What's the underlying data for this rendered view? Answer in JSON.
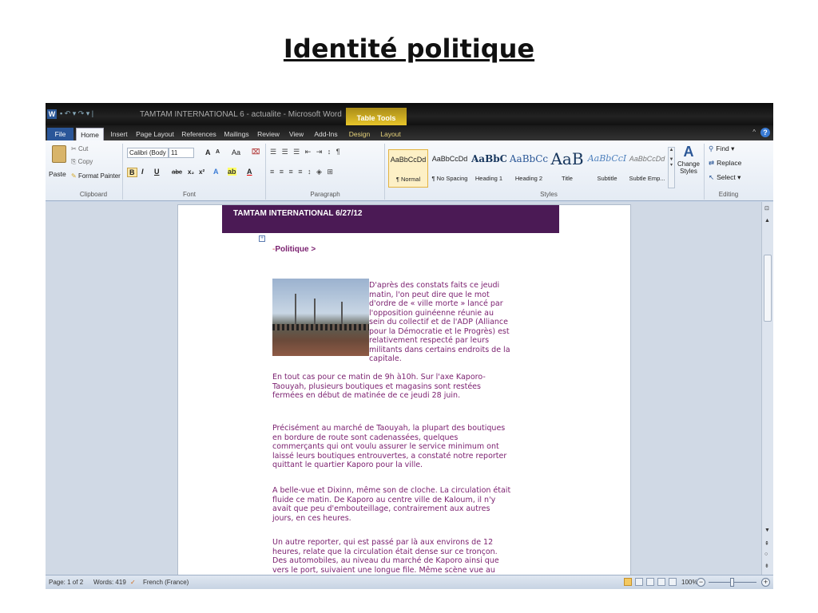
{
  "slide_title": "Identité politique",
  "window": {
    "title": "TAMTAM INTERNATIONAL 6 - actualite  -  Microsoft Word",
    "contextual_tab": "Table Tools",
    "app_icon": "W"
  },
  "tabs": [
    "File",
    "Home",
    "Insert",
    "Page Layout",
    "References",
    "Mailings",
    "Review",
    "View",
    "Add-Ins",
    "Design",
    "Layout"
  ],
  "ribbon": {
    "clipboard": {
      "paste": "Paste",
      "cut": "Cut",
      "copy": "Copy",
      "format_painter": "Format Painter",
      "label": "Clipboard"
    },
    "font": {
      "name": "Calibri (Body",
      "size": "11",
      "grow": "A",
      "shrink": "A",
      "case": "Aa",
      "label": "Font"
    },
    "paragraph": {
      "label": "Paragraph"
    },
    "styles": {
      "label": "Styles",
      "items": [
        {
          "sample": "AaBbCcDd",
          "name": "¶ Normal"
        },
        {
          "sample": "AaBbCcDd",
          "name": "¶ No Spacing"
        },
        {
          "sample": "AaBbCc",
          "name": "Heading 1"
        },
        {
          "sample": "AaBbCc",
          "name": "Heading 2"
        },
        {
          "sample": "AaB",
          "name": "Title"
        },
        {
          "sample": "AaBbCcI",
          "name": "Subtitle"
        },
        {
          "sample": "AaBbCcDd",
          "name": "Subtle Emp..."
        }
      ],
      "change_styles": "Change Styles"
    },
    "editing": {
      "find": "Find",
      "replace": "Replace",
      "select": "Select",
      "label": "Editing"
    }
  },
  "document": {
    "header": "TAMTAM INTERNATIONAL 6/27/12",
    "section": "Politique >",
    "para1": "D'après des constats faits ce jeudi matin, l'on peut dire que le mot d'ordre de « ville morte » lancé par l'opposition guinéenne réunie au sein du collectif et de l'ADP (Alliance pour la Démocratie et le Progrès) est relativement respecté par leurs militants dans certains endroits de la capitale.",
    "para2": "En tout cas pour ce matin de 9h à10h. Sur l'axe Kaporo- Taouyah, plusieurs boutiques et magasins sont restées fermées en début de matinée de ce jeudi 28 juin.",
    "para3": "Précisément au marché de Taouyah, la plupart des boutiques en bordure de route sont cadenassées, quelques commerçants qui ont voulu assurer le service minimum ont laissé leurs boutiques entrouvertes, a constaté notre reporter quittant le quartier Kaporo pour la ville.",
    "para4": "A belle-vue et Dixinn, même son de cloche. La circulation était fluide ce matin. De Kaporo au centre ville de Kaloum, il n'y avait que peu d'embouteillage, contrairement aux autres jours, en ces heures.",
    "para5": "Un autre reporter, qui est passé par là aux environs de 12 heures, relate que la circulation était dense sur ce tronçon. Des automobiles, au niveau du marché de Kaporo ainsi que vers le port, suivaient une longue file. Même scène vue au marché de Taouyah."
  },
  "status": {
    "page": "Page: 1 of 2",
    "words": "Words: 419",
    "language": "French (France)",
    "zoom": "100%"
  }
}
